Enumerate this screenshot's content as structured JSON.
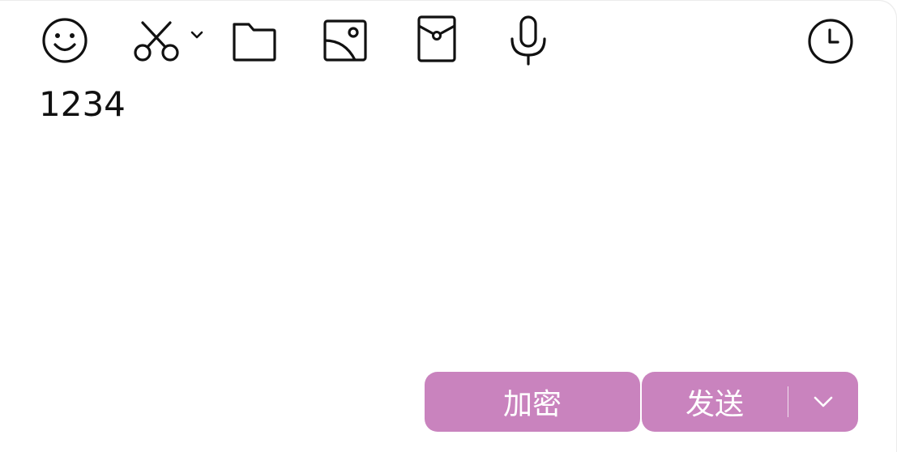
{
  "toolbar": {
    "icons": [
      "emoji-icon",
      "scissors-screenshot-icon",
      "chevron-down-icon",
      "folder-icon",
      "image-icon",
      "red-envelope-icon",
      "microphone-icon",
      "clock-history-icon"
    ]
  },
  "editor": {
    "text": "1234"
  },
  "actions": {
    "encrypt_label": "加密",
    "send_label": "发送"
  },
  "colors": {
    "button_bg": "#c983be",
    "button_text": "#ffffff",
    "icon_stroke": "#111111"
  }
}
